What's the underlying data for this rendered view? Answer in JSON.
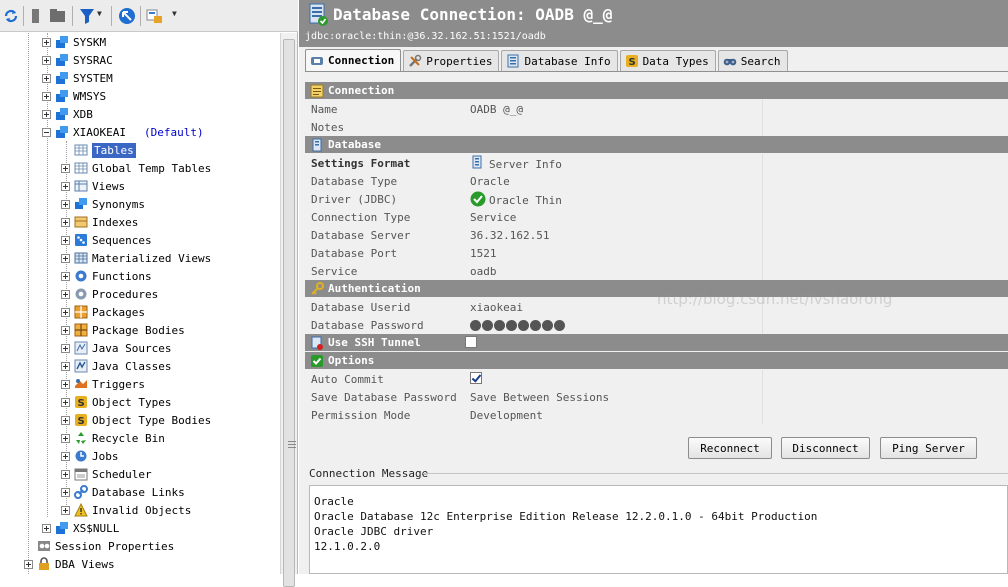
{
  "tree": {
    "schemas_before": [
      "SYSKM",
      "SYSRAC",
      "SYSTEM",
      "WMSYS",
      "XDB"
    ],
    "current_schema": {
      "name": "XIAOKEAI",
      "tag": "(Default)"
    },
    "children": [
      {
        "label": "Tables",
        "icon": "table-icon",
        "selected": true
      },
      {
        "label": "Global Temp Tables",
        "icon": "table-icon"
      },
      {
        "label": "Views",
        "icon": "view-icon"
      },
      {
        "label": "Synonyms",
        "icon": "synonym-icon"
      },
      {
        "label": "Indexes",
        "icon": "index-icon"
      },
      {
        "label": "Sequences",
        "icon": "sequence-icon"
      },
      {
        "label": "Materialized Views",
        "icon": "materialized-view-icon"
      },
      {
        "label": "Functions",
        "icon": "function-icon"
      },
      {
        "label": "Procedures",
        "icon": "procedure-icon"
      },
      {
        "label": "Packages",
        "icon": "package-icon"
      },
      {
        "label": "Package Bodies",
        "icon": "package-body-icon"
      },
      {
        "label": "Java Sources",
        "icon": "java-source-icon"
      },
      {
        "label": "Java Classes",
        "icon": "java-class-icon"
      },
      {
        "label": "Triggers",
        "icon": "trigger-icon"
      },
      {
        "label": "Object Types",
        "icon": "object-type-icon"
      },
      {
        "label": "Object Type Bodies",
        "icon": "object-type-body-icon"
      },
      {
        "label": "Recycle Bin",
        "icon": "recycle-bin-icon"
      },
      {
        "label": "Jobs",
        "icon": "jobs-icon"
      },
      {
        "label": "Scheduler",
        "icon": "scheduler-icon"
      },
      {
        "label": "Database Links",
        "icon": "database-link-icon"
      },
      {
        "label": "Invalid Objects",
        "icon": "warning-icon"
      }
    ],
    "schemas_after": [
      "XS$NULL"
    ],
    "root_items": [
      "Session Properties",
      "DBA Views"
    ]
  },
  "header": {
    "title": "Database Connection: OADB @_@",
    "subtitle": "jdbc:oracle:thin:@36.32.162.51:1521/oadb"
  },
  "tabs": [
    "Connection",
    "Properties",
    "Database Info",
    "Data Types",
    "Search"
  ],
  "connection": {
    "section_connection": "Connection",
    "name_label": "Name",
    "name_value": "OADB @_@",
    "notes_label": "Notes",
    "notes_value": "",
    "section_database": "Database",
    "settings_format_label": "Settings Format",
    "settings_format_value": "Server Info",
    "database_type_label": "Database Type",
    "database_type_value": "Oracle",
    "driver_label": "Driver (JDBC)",
    "driver_value": "Oracle Thin",
    "connection_type_label": "Connection Type",
    "connection_type_value": "Service",
    "database_server_label": "Database Server",
    "database_server_value": "36.32.162.51",
    "database_port_label": "Database Port",
    "database_port_value": "1521",
    "service_label": "Service",
    "service_value": "oadb",
    "section_auth": "Authentication",
    "userid_label": "Database Userid",
    "userid_value": "xiaokeai",
    "password_label": "Database Password",
    "password_dots": 8,
    "section_ssh": "Use SSH Tunnel",
    "ssh_checked": false,
    "section_options": "Options",
    "auto_commit_label": "Auto Commit",
    "auto_commit_checked": true,
    "save_password_label": "Save Database Password",
    "save_password_value": "Save Between Sessions",
    "permission_label": "Permission Mode",
    "permission_value": "Development"
  },
  "buttons": {
    "reconnect": "Reconnect",
    "disconnect": "Disconnect",
    "ping": "Ping Server"
  },
  "message": {
    "label": "Connection Message",
    "lines": [
      "Oracle",
      "Oracle Database 12c Enterprise Edition Release 12.2.0.1.0 - 64bit Production",
      "Oracle JDBC driver",
      "12.1.0.2.0"
    ]
  },
  "watermark": "http://blog.csdn.net/lvshaorong",
  "colors": {
    "section_bg": "#8c8c8c",
    "header_bg": "#8c8c8c",
    "link_blue": "#0000cc",
    "selected_bg": "#3a66c4"
  }
}
